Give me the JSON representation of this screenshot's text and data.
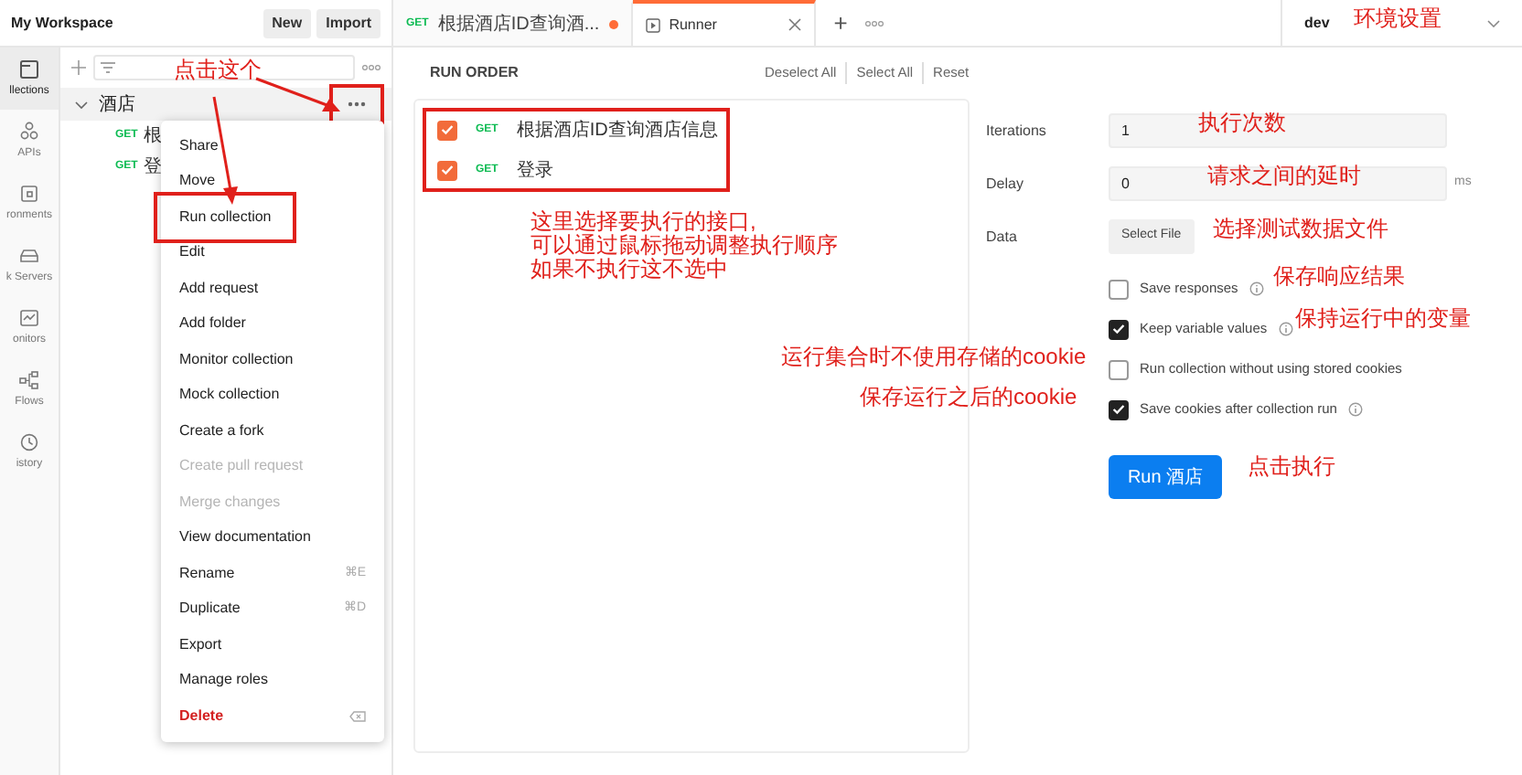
{
  "workspace": {
    "title": "My Workspace",
    "buttons": [
      "New",
      "Import"
    ]
  },
  "tabs": [
    {
      "kind": "request",
      "method": "GET",
      "label": "根据酒店ID查询酒...",
      "unsaved": true,
      "selected": false
    },
    {
      "kind": "runner",
      "label": "Runner",
      "selected": true
    }
  ],
  "tab_actions": {
    "add": "+"
  },
  "environment": {
    "value": "dev"
  },
  "rail": [
    {
      "label": "llections",
      "selected": true
    },
    {
      "label": "APIs",
      "selected": false
    },
    {
      "label": "ronments",
      "selected": false
    },
    {
      "label": "k Servers",
      "selected": false
    },
    {
      "label": "onitors",
      "selected": false
    },
    {
      "label": "Flows",
      "selected": false
    },
    {
      "label": "istory",
      "selected": false
    }
  ],
  "sidebar": {
    "collection": {
      "name": "酒店",
      "expanded": true,
      "requests": [
        {
          "method": "GET",
          "name": "根"
        },
        {
          "method": "GET",
          "name": "登"
        }
      ]
    }
  },
  "context_menu": [
    {
      "label": "Share",
      "kind": "normal"
    },
    {
      "label": "Move",
      "kind": "normal"
    },
    {
      "label": "Run collection",
      "kind": "normal"
    },
    {
      "label": "Edit",
      "kind": "normal"
    },
    {
      "label": "Add request",
      "kind": "normal"
    },
    {
      "label": "Add folder",
      "kind": "normal"
    },
    {
      "label": "Monitor collection",
      "kind": "normal"
    },
    {
      "label": "Mock collection",
      "kind": "normal"
    },
    {
      "label": "Create a fork",
      "kind": "normal"
    },
    {
      "label": "Create pull request",
      "kind": "disabled"
    },
    {
      "label": "Merge changes",
      "kind": "disabled"
    },
    {
      "label": "View documentation",
      "kind": "normal"
    },
    {
      "label": "Rename",
      "kind": "normal",
      "shortcut": "⌘E"
    },
    {
      "label": "Duplicate",
      "kind": "normal",
      "shortcut": "⌘D"
    },
    {
      "label": "Export",
      "kind": "normal"
    },
    {
      "label": "Manage roles",
      "kind": "normal"
    },
    {
      "label": "Delete",
      "kind": "danger"
    }
  ],
  "run_order": {
    "title": "RUN ORDER",
    "actions": [
      "Deselect All",
      "Select All",
      "Reset"
    ],
    "items": [
      {
        "method": "GET",
        "name": "根据酒店ID查询酒店信息",
        "checked": true
      },
      {
        "method": "GET",
        "name": "登录",
        "checked": true
      }
    ]
  },
  "settings": {
    "iterations": {
      "label": "Iterations",
      "value": "1"
    },
    "delay": {
      "label": "Delay",
      "value": "0",
      "unit": "ms"
    },
    "data": {
      "label": "Data",
      "button": "Select File"
    },
    "options": [
      {
        "label": "Save responses",
        "checked": false,
        "info": true
      },
      {
        "label": "Keep variable values",
        "checked": true,
        "info": true
      },
      {
        "label": "Run collection without using stored cookies",
        "checked": false,
        "info": false
      },
      {
        "label": "Save cookies after collection run",
        "checked": true,
        "info": true
      }
    ],
    "run_button": "Run 酒店"
  },
  "annotations": [
    "环境设置",
    "点击这个",
    "执行次数",
    "请求之间的延时",
    "这里选择要执行的接口,",
    "选择测试数据文件",
    "可以通过鼠标拖动调整执行顺序",
    "如果不执行这不选中",
    "保存响应结果",
    "保持运行中的变量",
    "运行集合时不使用存储的cookie",
    "保存运行之后的cookie",
    "点击执行"
  ]
}
